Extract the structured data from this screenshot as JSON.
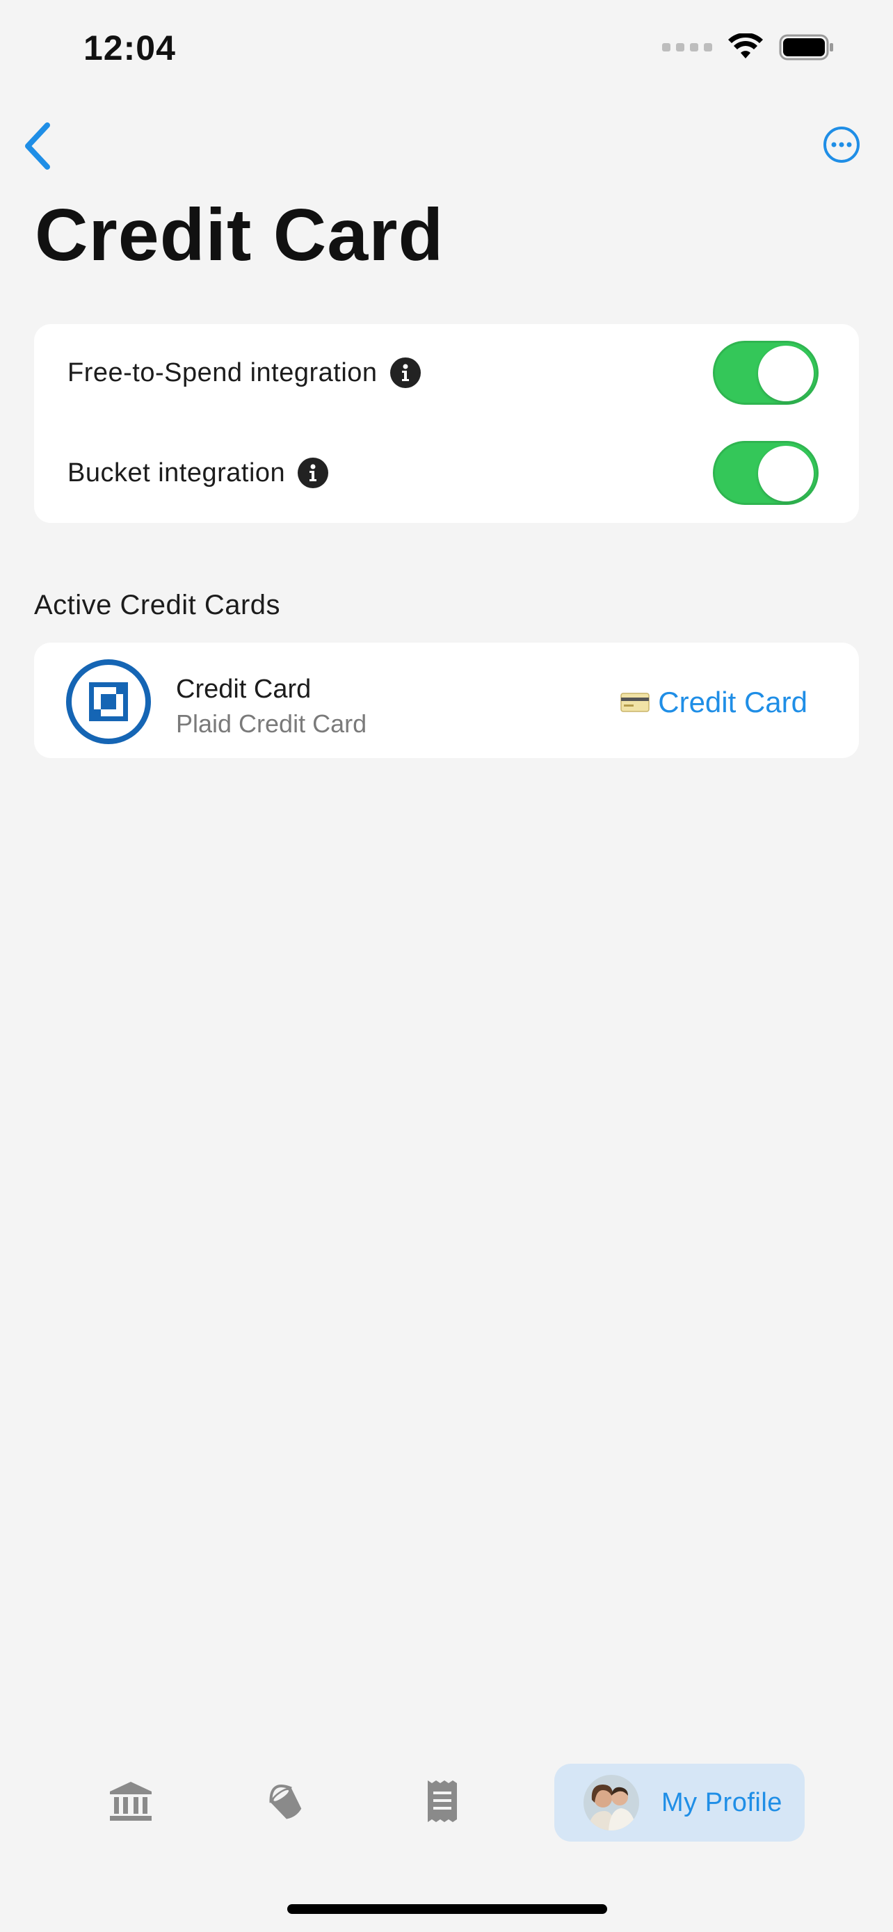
{
  "status_bar": {
    "time": "12:04"
  },
  "header": {
    "title": "Credit Card"
  },
  "settings": [
    {
      "label": "Free-to-Spend integration",
      "enabled": true
    },
    {
      "label": "Bucket integration",
      "enabled": true
    }
  ],
  "active_section": {
    "title": "Active Credit Cards",
    "accounts": [
      {
        "name": "Credit Card",
        "subtitle": "Plaid Credit Card",
        "type_label": "Credit Card",
        "type_icon": "credit-card-emoji"
      }
    ]
  },
  "tabbar": {
    "items": [
      {
        "icon": "bank-icon"
      },
      {
        "icon": "bucket-icon"
      },
      {
        "icon": "receipt-icon"
      },
      {
        "icon": "avatar",
        "label": "My Profile",
        "active": true
      }
    ]
  },
  "colors": {
    "accent": "#1f8ee6",
    "toggle_on": "#34c759",
    "background": "#f4f4f4",
    "bank_blue": "#1565b4"
  }
}
